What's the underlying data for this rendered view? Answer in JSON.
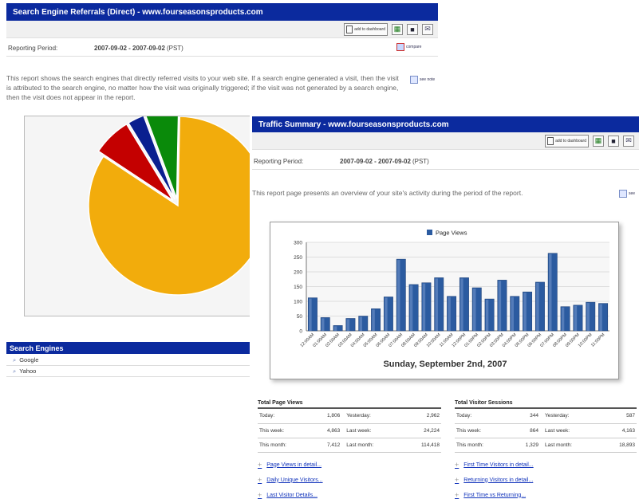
{
  "back_report": {
    "title": "Search Engine Referrals (Direct) - www.fourseasonsproducts.com",
    "toolbar": {
      "add_label": "add to dashboard"
    },
    "period_label": "Reporting Period:",
    "period_value": "2007-09-02 - 2007-09-02",
    "period_tz": "(PST)",
    "compare_label": "compare",
    "description": "This report shows the search engines that directly referred visits to your web site. If a search engine generated a visit, then the visit is attributed to the search engine, no matter how the visit was originally triggered; if the visit was not generated by a search engine, then the visit does not appear in the report.",
    "help_label": "see note",
    "engines_header": "Search Engines",
    "engines": [
      "Google",
      "Yahoo"
    ]
  },
  "pie_chart": {
    "chart_data": {
      "type": "pie",
      "slices": [
        {
          "value": 84,
          "color": "#f2ac0c"
        },
        {
          "value": 7,
          "color": "#c40000"
        },
        {
          "value": 3,
          "color": "#0a1f8f"
        },
        {
          "value": 6,
          "color": "#0a8a0a"
        }
      ]
    }
  },
  "front_report": {
    "title": "Traffic Summary - www.fourseasonsproducts.com",
    "toolbar": {
      "add_label": "add to dashboard"
    },
    "period_label": "Reporting Period:",
    "period_value": "2007-09-02 - 2007-09-02",
    "period_tz": "(PST)",
    "description": "This report page presents an overview of your site's activity during the period of the report.",
    "help_label": "see",
    "chart_data": {
      "type": "bar",
      "series": [
        {
          "name": "Page Views"
        }
      ],
      "title": "Sunday, September 2nd, 2007",
      "ylim": [
        0,
        300
      ],
      "yticks": [
        0,
        50,
        100,
        150,
        200,
        250,
        300
      ],
      "categories": [
        "12:00AM",
        "01:00AM",
        "02:00AM",
        "03:00AM",
        "04:00AM",
        "05:00AM",
        "06:00AM",
        "07:00AM",
        "08:00AM",
        "09:00AM",
        "10:00AM",
        "11:00AM",
        "12:00PM",
        "01:00PM",
        "02:00PM",
        "03:00PM",
        "04:00PM",
        "05:00PM",
        "06:00PM",
        "07:00PM",
        "08:00PM",
        "09:00PM",
        "10:00PM",
        "11:00PM"
      ],
      "values": [
        112,
        45,
        18,
        42,
        50,
        75,
        115,
        243,
        157,
        163,
        180,
        117,
        180,
        146,
        108,
        172,
        117,
        132,
        165,
        263,
        82,
        87,
        97,
        93
      ],
      "bar_color": "#2b5ba0"
    },
    "page_views": {
      "title": "Total Page Views",
      "rows": [
        {
          "l1": "Today:",
          "v1": "1,806",
          "l2": "Yesterday:",
          "v2": "2,962"
        },
        {
          "l1": "This week:",
          "v1": "4,863",
          "l2": "Last week:",
          "v2": "24,224"
        },
        {
          "l1": "This month:",
          "v1": "7,412",
          "l2": "Last month:",
          "v2": "114,418"
        }
      ],
      "links": [
        "Page Views in detail...",
        "Daily Unique Visitors...",
        "Last Visitor Details..."
      ]
    },
    "visitor_sessions": {
      "title": "Total Visitor Sessions",
      "rows": [
        {
          "l1": "Today:",
          "v1": "344",
          "l2": "Yesterday:",
          "v2": "587"
        },
        {
          "l1": "This week:",
          "v1": "864",
          "l2": "Last week:",
          "v2": "4,163"
        },
        {
          "l1": "This month:",
          "v1": "1,329",
          "l2": "Last month:",
          "v2": "18,893"
        }
      ],
      "links": [
        "First Time Visitors in detail...",
        "Returning Visitors in detail...",
        "First Time vs Returning..."
      ]
    }
  }
}
